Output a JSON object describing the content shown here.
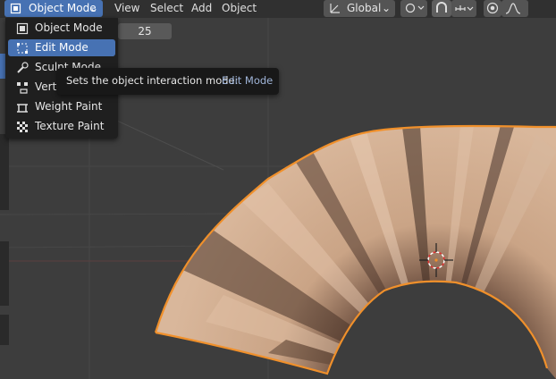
{
  "header": {
    "mode_label": "Object Mode",
    "menus": [
      "View",
      "Select",
      "Add",
      "Object"
    ],
    "transform_orientation": "Global"
  },
  "subbar": {
    "value": "25"
  },
  "mode_menu": {
    "items": [
      {
        "label": "Object Mode",
        "icon": "object-mode-icon"
      },
      {
        "label": "Edit Mode",
        "icon": "edit-mode-icon",
        "active": true
      },
      {
        "label": "Sculpt Mode",
        "icon": "sculpt-mode-icon"
      },
      {
        "label": "Vertex Paint",
        "icon": "vertex-paint-icon"
      },
      {
        "label": "Weight Paint",
        "icon": "weight-paint-icon"
      },
      {
        "label": "Texture Paint",
        "icon": "texture-paint-icon"
      }
    ]
  },
  "tooltip": {
    "text": "Sets the object interaction mode:",
    "value": "Edit Mode"
  },
  "colors": {
    "accent": "#4772b3",
    "selection_outline": "#f0902b",
    "mesh_color": "#c9a383"
  }
}
